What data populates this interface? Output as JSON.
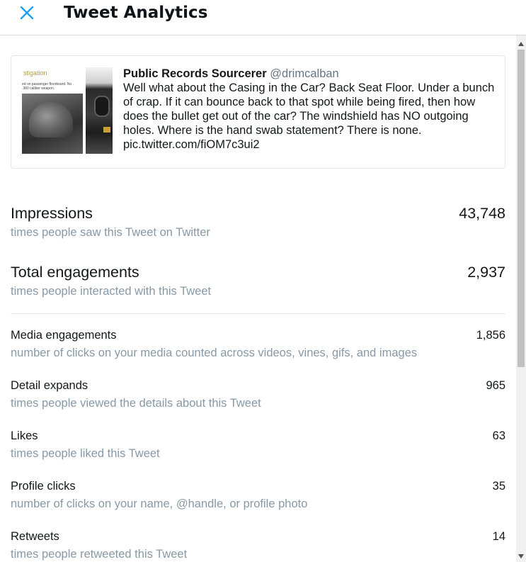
{
  "header": {
    "title": "Tweet Analytics",
    "close_icon": "close-icon"
  },
  "colors": {
    "accent": "#1da1f2",
    "text_primary": "#14171a",
    "text_secondary": "#8899a6",
    "handle": "#657786",
    "border": "#e1e8ed"
  },
  "tweet": {
    "thumbnail_caption": "stigation",
    "thumbnail_small_text": "ed on passenger floorboard. No . .380 caliber weapon.",
    "author_name": "Public Records Sourcerer",
    "author_handle": "@drimcalban",
    "body": "Well what about the Casing in the Car?  Back Seat Floor.  Under a bunch of crap.   If it can bounce back to that spot while being fired, then how does the bullet get out of the car?  The windshield has NO outgoing holes.  Where is the hand swab statement?  There is none. pic.twitter.com/fiOM7c3ui2"
  },
  "metrics": [
    {
      "label": "Impressions",
      "value": "43,748",
      "description": "times people saw this Tweet on Twitter"
    },
    {
      "label": "Total engagements",
      "value": "2,937",
      "description": "times people interacted with this Tweet"
    },
    {
      "label": "Media engagements",
      "value": "1,856",
      "description": "number of clicks on your media counted across videos, vines, gifs, and images"
    },
    {
      "label": "Detail expands",
      "value": "965",
      "description": "times people viewed the details about this Tweet"
    },
    {
      "label": "Likes",
      "value": "63",
      "description": "times people liked this Tweet"
    },
    {
      "label": "Profile clicks",
      "value": "35",
      "description": "number of clicks on your name, @handle, or profile photo"
    },
    {
      "label": "Retweets",
      "value": "14",
      "description": "times people retweeted this Tweet"
    }
  ]
}
